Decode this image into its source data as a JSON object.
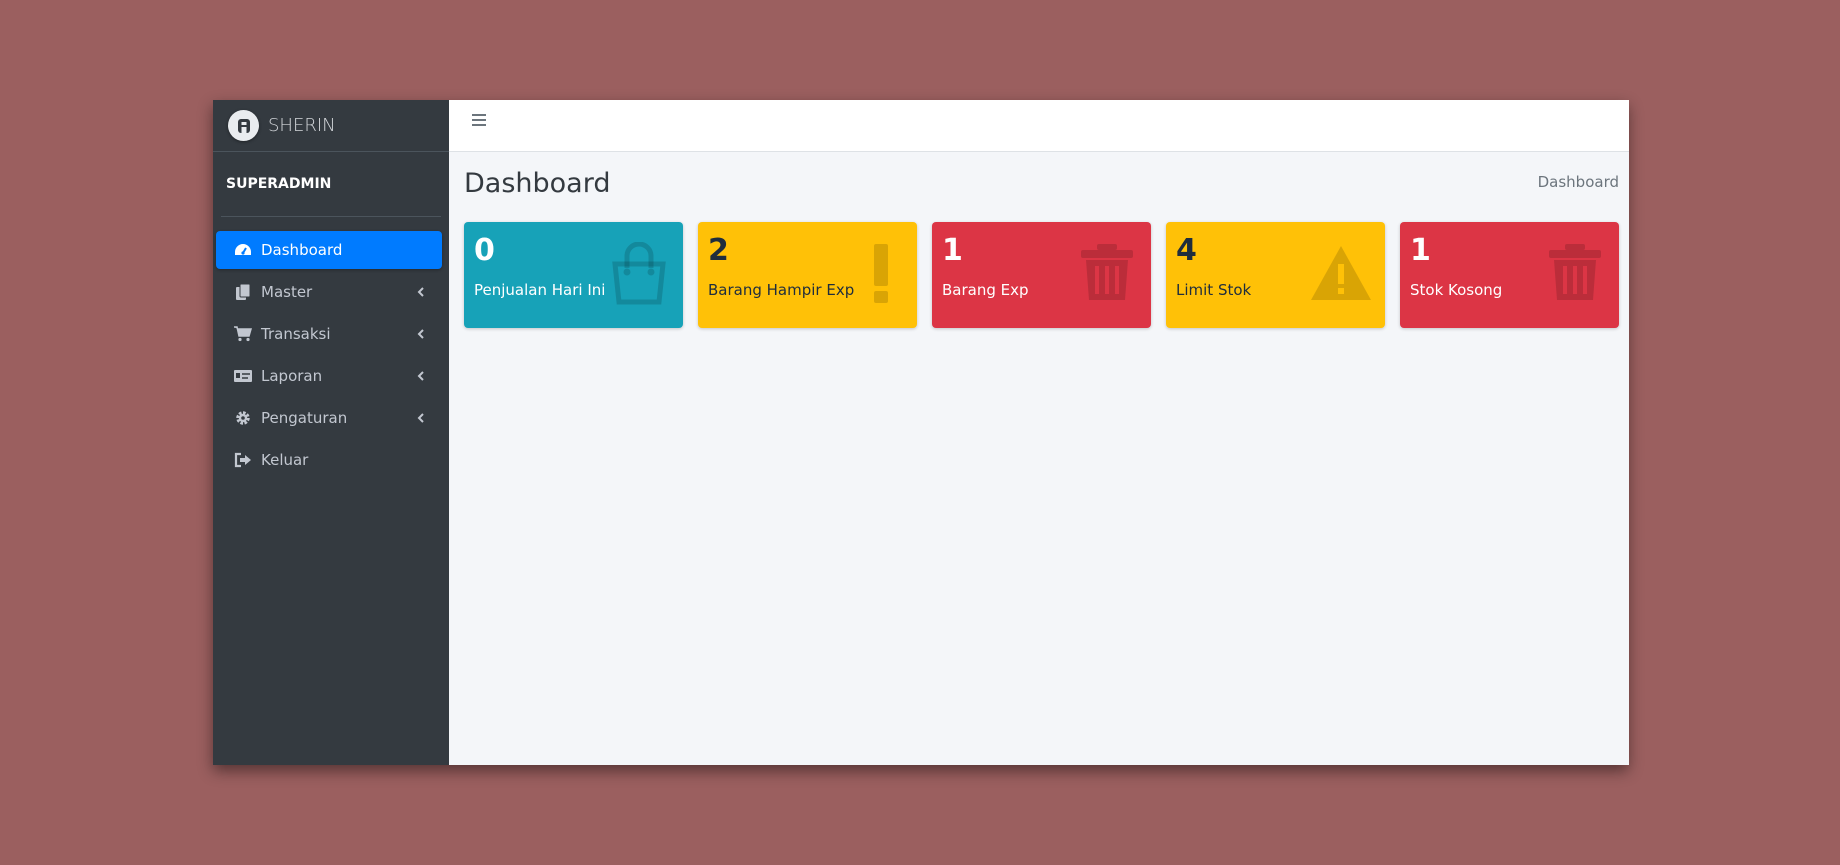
{
  "brand": {
    "name": "SHERIN",
    "logo_icon": "letter-a-logo"
  },
  "user": {
    "name": "SUPERADMIN"
  },
  "sidebar": {
    "items": [
      {
        "label": "Dashboard",
        "icon": "tachometer-icon",
        "active": true
      },
      {
        "label": "Master",
        "icon": "copy-icon",
        "has_children": true
      },
      {
        "label": "Transaksi",
        "icon": "cart-icon",
        "has_children": true
      },
      {
        "label": "Laporan",
        "icon": "money-check-icon",
        "has_children": true
      },
      {
        "label": "Pengaturan",
        "icon": "gear-icon",
        "has_children": true
      },
      {
        "label": "Keluar",
        "icon": "sign-out-icon"
      }
    ]
  },
  "header": {
    "menu_icon": "hamburger-icon"
  },
  "content": {
    "title": "Dashboard",
    "breadcrumb": "Dashboard"
  },
  "boxes": [
    {
      "value": "0",
      "label": "Penjualan Hari Ini",
      "color": "#17a2b8",
      "icon": "shopping-bag-icon"
    },
    {
      "value": "2",
      "label": "Barang Hampir Exp",
      "color": "#ffc107",
      "icon": "exclamation-icon"
    },
    {
      "value": "1",
      "label": "Barang Exp",
      "color": "#dc3545",
      "icon": "trash-icon"
    },
    {
      "value": "4",
      "label": "Limit Stok",
      "color": "#ffc107",
      "icon": "warning-icon"
    },
    {
      "value": "1",
      "label": "Stok Kosong",
      "color": "#dc3545",
      "icon": "trash-icon"
    }
  ],
  "colors": {
    "sidebar_bg": "#343a40",
    "active": "#007bff",
    "page_bg": "#9b5f5f"
  }
}
